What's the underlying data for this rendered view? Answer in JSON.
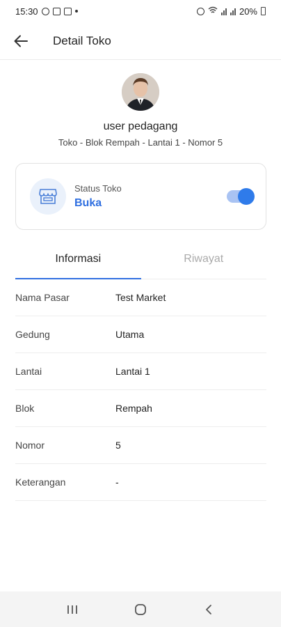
{
  "status_bar": {
    "time": "15:30",
    "battery": "20%"
  },
  "app_bar": {
    "title": "Detail Toko",
    "back_icon": "arrow-left-icon"
  },
  "profile": {
    "name": "user pedagang",
    "subtitle": "Toko - Blok Rempah - Lantai 1 - Nomor 5"
  },
  "status_card": {
    "label": "Status Toko",
    "value": "Buka",
    "toggle_on": true,
    "accent_color": "#2f6fe0"
  },
  "tabs": [
    {
      "label": "Informasi",
      "active": true
    },
    {
      "label": "Riwayat",
      "active": false
    }
  ],
  "info": [
    {
      "key": "Nama Pasar",
      "value": "Test Market"
    },
    {
      "key": "Gedung",
      "value": "Utama"
    },
    {
      "key": "Lantai",
      "value": "Lantai 1"
    },
    {
      "key": "Blok",
      "value": "Rempah"
    },
    {
      "key": "Nomor",
      "value": "5"
    },
    {
      "key": "Keterangan",
      "value": "-"
    }
  ],
  "nav_bar": {
    "icons": [
      "recent-apps-icon",
      "home-icon",
      "back-icon"
    ]
  }
}
